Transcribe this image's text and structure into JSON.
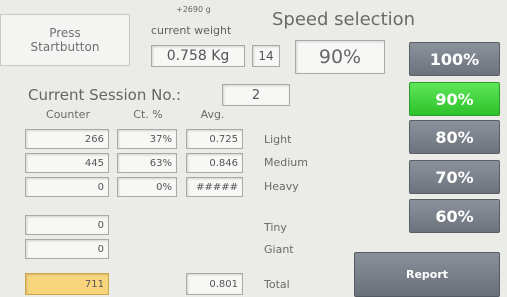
{
  "start_button": {
    "label": "Press\nStartbutton"
  },
  "weight": {
    "offset": "+2690 g",
    "label": "current weight",
    "value": "0.758 Kg",
    "count": "14"
  },
  "speed": {
    "title": "Speed selection",
    "current": "90%",
    "options": [
      "100%",
      "90%",
      "80%",
      "70%",
      "60%"
    ],
    "active": "90%",
    "colors": {
      "active": "#3ad236",
      "inactive": "#7a8089"
    }
  },
  "session": {
    "label": "Current Session No.:",
    "number": "2"
  },
  "table": {
    "headers": [
      "Counter",
      "Ct. %",
      "Avg."
    ],
    "rows": [
      {
        "counter": "266",
        "pct": "37%",
        "avg": "0.725",
        "label": "Light"
      },
      {
        "counter": "445",
        "pct": "63%",
        "avg": "0.846",
        "label": "Medium"
      },
      {
        "counter": "0",
        "pct": "0%",
        "avg": "#####",
        "label": "Heavy"
      }
    ],
    "extra": [
      {
        "counter": "0",
        "label": "Tiny"
      },
      {
        "counter": "0",
        "label": "Giant"
      }
    ],
    "total": {
      "counter": "711",
      "avg": "0.801",
      "label": "Total"
    }
  },
  "report_button": {
    "label": "Report"
  }
}
